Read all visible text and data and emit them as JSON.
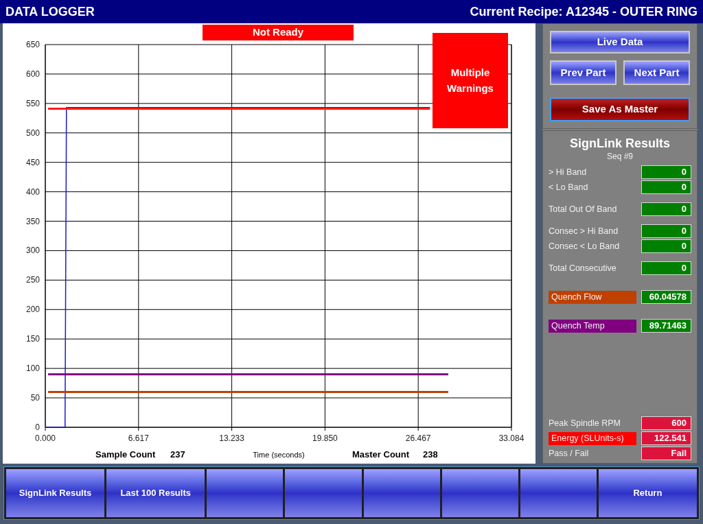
{
  "header": {
    "title": "DATA LOGGER",
    "recipe": "Current Recipe: A12345 - OUTER RING"
  },
  "status_banner": "Not Ready",
  "warning_banner": "Multiple Warnings",
  "chart": {
    "chart_data": {
      "type": "line",
      "xlabel": "Time (seconds)",
      "grid": true,
      "xlim": [
        0,
        33.084
      ],
      "ylim": [
        0,
        650
      ],
      "xticks": [
        {
          "value": 0,
          "label": "0.000"
        },
        {
          "value": 6.617,
          "label": "6.617"
        },
        {
          "value": 13.233,
          "label": "13.233"
        },
        {
          "value": 19.85,
          "label": "19.850"
        },
        {
          "value": 26.467,
          "label": "26.467"
        },
        {
          "value": 33.084,
          "label": "33.084"
        }
      ],
      "yticks": [
        0,
        50,
        100,
        150,
        200,
        250,
        300,
        350,
        400,
        450,
        500,
        550,
        600,
        650
      ],
      "x": [
        0,
        0.2,
        1.4,
        1.5,
        27.3,
        28.6
      ],
      "series": [
        {
          "color": "#1a1acc",
          "values": [
            0,
            0,
            0,
            543,
            543,
            null
          ]
        },
        {
          "color": "#ff1a1a",
          "values": [
            null,
            541,
            541,
            541,
            541,
            null
          ]
        },
        {
          "color": "#800080",
          "values": [
            null,
            90,
            90,
            90,
            90,
            90
          ]
        },
        {
          "color": "#c04000",
          "values": [
            null,
            60,
            60,
            60,
            60,
            60
          ]
        }
      ]
    }
  },
  "sample_count": {
    "label": "Sample Count",
    "value": "237"
  },
  "master_count": {
    "label": "Master Count",
    "value": "238"
  },
  "nav_buttons": {
    "live": "Live Data",
    "prev": "Prev Part",
    "next": "Next Part",
    "save": "Save As Master"
  },
  "results": {
    "title": "SignLink Results",
    "subtitle": "Seq #9",
    "groups": [
      [
        {
          "label": {
            "text": "> Hi Band"
          },
          "value": {
            "text": "0",
            "color": "#008000"
          }
        },
        {
          "label": {
            "text": "< Lo Band"
          },
          "value": {
            "text": "0",
            "color": "#008000"
          }
        }
      ],
      [
        {
          "label": {
            "text": "Total Out Of Band"
          },
          "value": {
            "text": "0",
            "color": "#008000"
          }
        }
      ],
      [
        {
          "label": {
            "text": "Consec > Hi Band"
          },
          "value": {
            "text": "0",
            "color": "#008000"
          }
        },
        {
          "label": {
            "text": "Consec < Lo Band"
          },
          "value": {
            "text": "0",
            "color": "#008000"
          }
        }
      ],
      [
        {
          "label": {
            "text": "Total Consecutive"
          },
          "value": {
            "text": "0",
            "color": "#008000"
          }
        }
      ],
      [
        {
          "label": {
            "text": "Quench Flow",
            "color": "#c04000"
          },
          "value": {
            "text": "60.04578",
            "color": "#008000"
          }
        }
      ],
      [
        {
          "label": {
            "text": "Quench Temp",
            "color": "#800080"
          },
          "value": {
            "text": "89.71463",
            "color": "#008000"
          }
        }
      ]
    ],
    "summary": [
      {
        "label": {
          "text": "Peak Spindle RPM"
        },
        "value": {
          "text": "600",
          "color": "#dc143c"
        }
      },
      {
        "label": {
          "text": "Energy (SLUnits-s)",
          "color": "#ff0000"
        },
        "value": {
          "text": "122.541",
          "color": "#dc143c"
        }
      },
      {
        "label": {
          "text": "Pass / Fail"
        },
        "value": {
          "text": "Fail",
          "color": "#dc143c"
        }
      }
    ]
  },
  "function_keys": [
    {
      "kind": "labeled",
      "label": "SignLink Results"
    },
    {
      "kind": "labeled",
      "label": "Last 100 Results"
    },
    {
      "kind": "blank"
    },
    {
      "kind": "blank"
    },
    {
      "kind": "blank"
    },
    {
      "kind": "blank"
    },
    {
      "kind": "blank"
    },
    {
      "kind": "labeled",
      "label": "Return"
    }
  ]
}
